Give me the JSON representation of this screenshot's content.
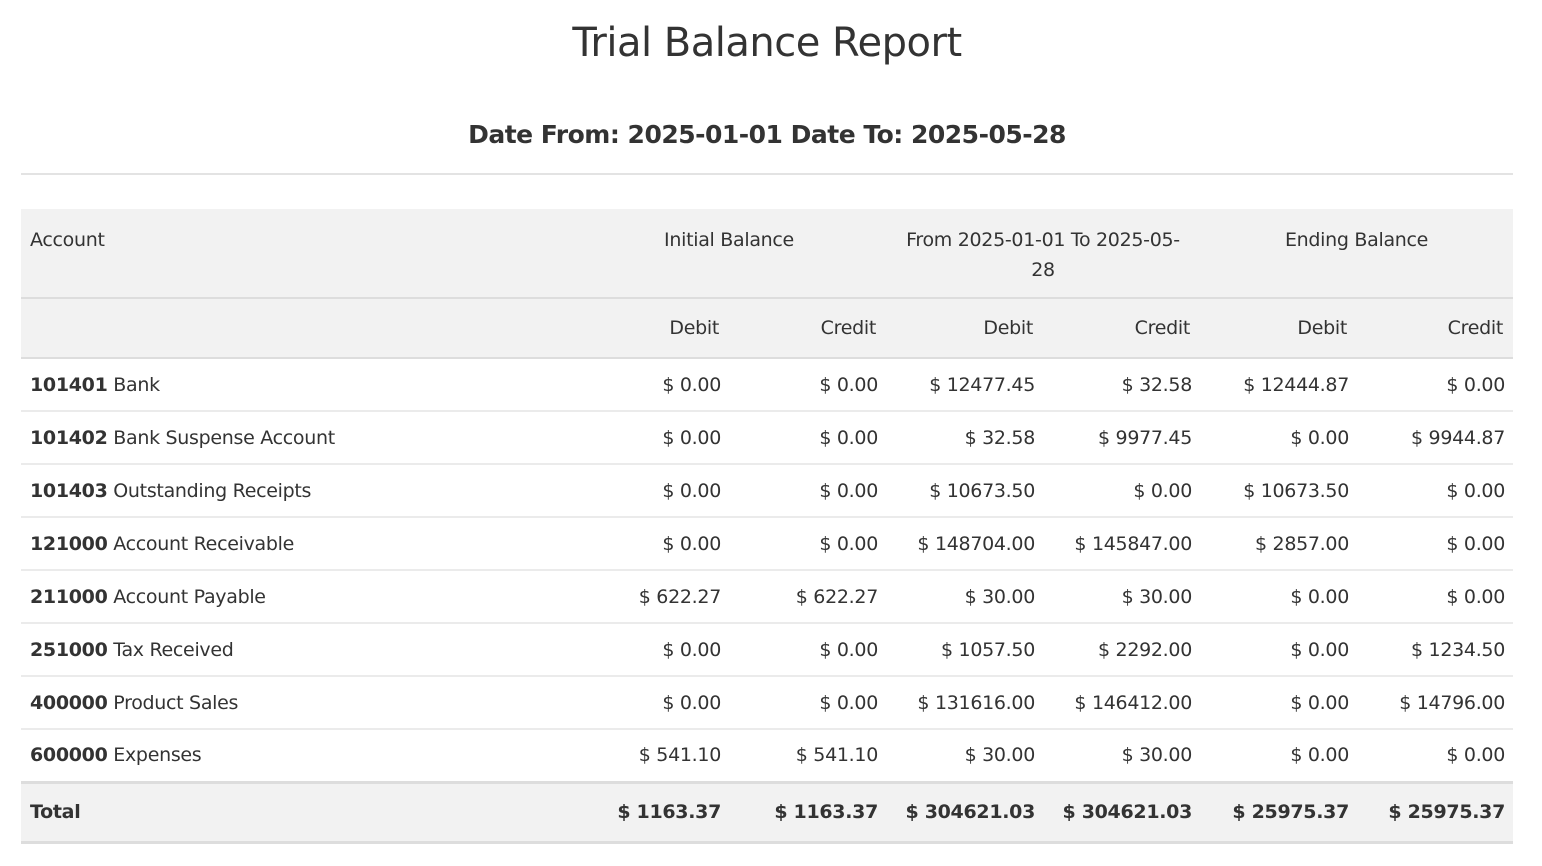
{
  "report": {
    "title": "Trial Balance Report",
    "date_range": "Date From: 2025-01-01 Date To: 2025-05-28"
  },
  "table": {
    "header_account": "Account",
    "groups": [
      "Initial Balance",
      "From 2025-01-01 To 2025-05-28",
      "Ending Balance"
    ],
    "subheaders": [
      "Debit",
      "Credit",
      "Debit",
      "Credit",
      "Debit",
      "Credit"
    ],
    "rows": [
      {
        "code": "101401",
        "name": "Bank",
        "values": [
          "$ 0.00",
          "$ 0.00",
          "$ 12477.45",
          "$ 32.58",
          "$ 12444.87",
          "$ 0.00"
        ]
      },
      {
        "code": "101402",
        "name": "Bank Suspense Account",
        "values": [
          "$ 0.00",
          "$ 0.00",
          "$ 32.58",
          "$ 9977.45",
          "$ 0.00",
          "$ 9944.87"
        ]
      },
      {
        "code": "101403",
        "name": "Outstanding Receipts",
        "values": [
          "$ 0.00",
          "$ 0.00",
          "$ 10673.50",
          "$ 0.00",
          "$ 10673.50",
          "$ 0.00"
        ]
      },
      {
        "code": "121000",
        "name": "Account Receivable",
        "values": [
          "$ 0.00",
          "$ 0.00",
          "$ 148704.00",
          "$ 145847.00",
          "$ 2857.00",
          "$ 0.00"
        ]
      },
      {
        "code": "211000",
        "name": "Account Payable",
        "values": [
          "$ 622.27",
          "$ 622.27",
          "$ 30.00",
          "$ 30.00",
          "$ 0.00",
          "$ 0.00"
        ]
      },
      {
        "code": "251000",
        "name": "Tax Received",
        "values": [
          "$ 0.00",
          "$ 0.00",
          "$ 1057.50",
          "$ 2292.00",
          "$ 0.00",
          "$ 1234.50"
        ]
      },
      {
        "code": "400000",
        "name": "Product Sales",
        "values": [
          "$ 0.00",
          "$ 0.00",
          "$ 131616.00",
          "$ 146412.00",
          "$ 0.00",
          "$ 14796.00"
        ]
      },
      {
        "code": "600000",
        "name": "Expenses",
        "values": [
          "$ 541.10",
          "$ 541.10",
          "$ 30.00",
          "$ 30.00",
          "$ 0.00",
          "$ 0.00"
        ]
      }
    ],
    "total": {
      "label": "Total",
      "values": [
        "$ 1163.37",
        "$ 1163.37",
        "$ 304621.03",
        "$ 304621.03",
        "$ 25975.37",
        "$ 25975.37"
      ]
    }
  }
}
